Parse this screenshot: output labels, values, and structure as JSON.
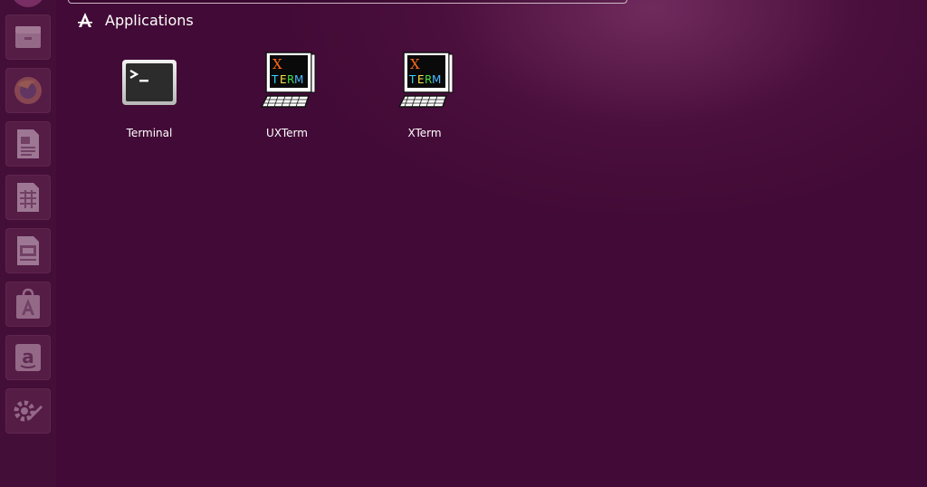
{
  "colors": {
    "background": "#420a36",
    "launcher_tile": "#78376a",
    "text": "#ffffff",
    "xterm_x": "#ff6a1a",
    "xterm_t": "#3ad4ff",
    "xterm_e": "#ffe14a",
    "xterm_r": "#4ade4a",
    "xterm_m": "#4ab8ff"
  },
  "launcher": {
    "items": [
      {
        "name": "files-icon"
      },
      {
        "name": "firefox-icon"
      },
      {
        "name": "writer-icon"
      },
      {
        "name": "calc-icon"
      },
      {
        "name": "impress-icon"
      },
      {
        "name": "software-center-icon"
      },
      {
        "name": "amazon-icon"
      },
      {
        "name": "system-settings-icon"
      }
    ]
  },
  "category": {
    "icon": "applications-icon",
    "title": "Applications"
  },
  "results": [
    {
      "label": "Terminal",
      "icon": "terminal-icon"
    },
    {
      "label": "UXTerm",
      "icon": "xterm-icon",
      "glyph_x": "X",
      "glyph_term": [
        "T",
        "E",
        "R",
        "M"
      ]
    },
    {
      "label": "XTerm",
      "icon": "xterm-icon",
      "glyph_x": "X",
      "glyph_term": [
        "T",
        "E",
        "R",
        "M"
      ]
    }
  ]
}
